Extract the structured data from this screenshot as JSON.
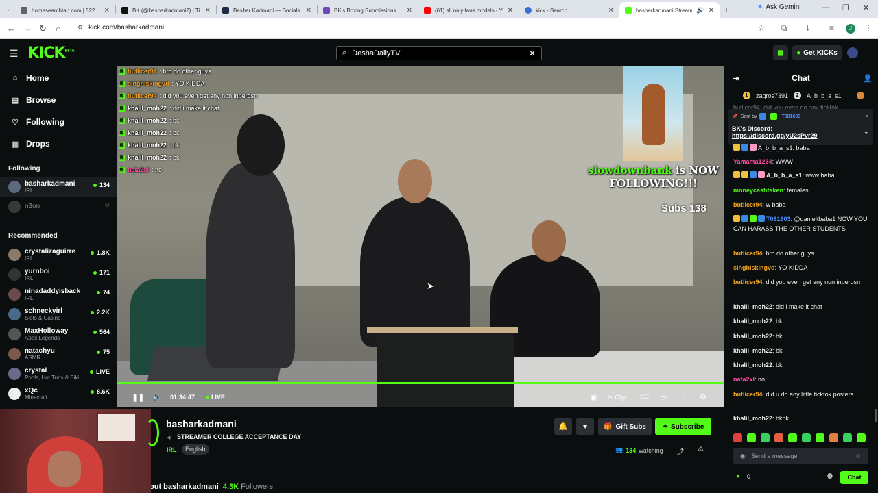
{
  "browser": {
    "tabs": [
      {
        "title": "homesearchtab.com | 522",
        "color": "#5f6368"
      },
      {
        "title": "BK (@basharkadmani2) | Ti",
        "color": "#111111"
      },
      {
        "title": "Bashar Kadmani — Socials",
        "color": "#1f2a44"
      },
      {
        "title": "BK's Boxing Submissions",
        "color": "#7248b9"
      },
      {
        "title": "(61) all only fans models - Y",
        "color": "#ff0000"
      },
      {
        "title": "kick - Search",
        "color": "#3b6fd6"
      },
      {
        "title": "basharkadmani Stream",
        "color": "#53fc18"
      }
    ],
    "gemini_label": "Ask Gemini",
    "url": "kick.com/basharkadmani",
    "profile_letter": "J"
  },
  "header": {
    "logo": "KICK",
    "logo_sup": "BETA",
    "search_value": "DeshaDailyTV",
    "get_kicks": "Get KICKs"
  },
  "sidebar": {
    "nav": [
      {
        "label": "Home",
        "icon": "home-icon"
      },
      {
        "label": "Browse",
        "icon": "browse-icon"
      },
      {
        "label": "Following",
        "icon": "heart-icon"
      },
      {
        "label": "Drops",
        "icon": "drops-icon"
      }
    ],
    "following_heading": "Following",
    "following": [
      {
        "name": "basharkadmani",
        "category": "IRL",
        "viewers": "134"
      },
      {
        "name": "n3on",
        "category": "",
        "viewers": ""
      }
    ],
    "recommended_heading": "Recommended",
    "recommended": [
      {
        "name": "crystalizaguirre",
        "category": "IRL",
        "viewers": "1.8K"
      },
      {
        "name": "yurnboi",
        "category": "IRL",
        "viewers": "171"
      },
      {
        "name": "ninadaddyisback",
        "category": "IRL",
        "viewers": "74"
      },
      {
        "name": "schneckyirl",
        "category": "Slots & Casino",
        "viewers": "2.2K"
      },
      {
        "name": "MaxHolloway",
        "category": "Apex Legends",
        "viewers": "564"
      },
      {
        "name": "natachyu",
        "category": "ASMR",
        "viewers": "75"
      },
      {
        "name": "crystal",
        "category": "Pools, Hot Tubs & Biki...",
        "viewers": "LIVE"
      },
      {
        "name": "xQc",
        "category": "Minecraft",
        "viewers": "8.6K"
      }
    ]
  },
  "video": {
    "overlay_chat": [
      {
        "user": "butlicer94",
        "color": "#f0a020",
        "text": ": bro do other guys"
      },
      {
        "user": "singhiskingvd",
        "color": "#f0a020",
        "text": ": YO KIDDA"
      },
      {
        "user": "butlicer94",
        "color": "#f0a020",
        "text": ": did you even get any non inperosn"
      },
      {
        "user": "khalil_moh22",
        "color": "#ffffff",
        "text": ": did i make it chat"
      },
      {
        "user": "khalil_moh22",
        "color": "#ffffff",
        "text": ": bk"
      },
      {
        "user": "khalil_moh22",
        "color": "#ffffff",
        "text": ": bk"
      },
      {
        "user": "khalil_moh22",
        "color": "#ffffff",
        "text": ": bk"
      },
      {
        "user": "khalil_moh22",
        "color": "#ffffff",
        "text": ": bk"
      },
      {
        "user": "nata2xl",
        "color": "#ff4fa0",
        "text": ": no"
      }
    ],
    "alert_name": "slowdownbank",
    "alert_text_1": " is NOW",
    "alert_text_2": "FOLLOWING!!!",
    "subs": "Subs 138",
    "time": "01:34:47",
    "live": "LIVE",
    "clip": "Clip"
  },
  "channel": {
    "name": "basharkadmani",
    "title": "STREAMER COLLEGE ACCEPTANCE DAY",
    "category": "IRL",
    "language": "English",
    "gift": "Gift Subs",
    "subscribe": "Subscribe",
    "watching_count": "134",
    "watching_label": "watching",
    "about_prefix": "out basharkadmani",
    "followers_count": "4.3K",
    "followers_label": "Followers"
  },
  "chat": {
    "title": "Chat",
    "leaderboard": [
      {
        "name": "zagros7391",
        "rank": "1"
      },
      {
        "name": "A_b_b_a_s1",
        "rank": "2"
      }
    ],
    "pinned": {
      "sent_by": "Sent by",
      "sender": "T081603",
      "text": "BK's Discord:",
      "link": "https://discord.gg/yU2sPvr29"
    },
    "messages": [
      {
        "user": "",
        "color": "#ffffff",
        "text": "A_b_b_a_s1: baba"
      },
      {
        "user": "Yamama1234",
        "color": "#ff4fa0",
        "text": ": WWW"
      },
      {
        "user": "A_b_b_a_s1",
        "color": "#ffffff",
        "text": ": www baba"
      },
      {
        "user": "moneycashtaken",
        "color": "#53fc18",
        "text": ": females"
      },
      {
        "user": "butlicer94",
        "color": "#f0a020",
        "text": ": w baba"
      },
      {
        "user": "T081603",
        "color": "#4f8fff",
        "text": ": @danieltbaba1 NOW YOU CAN HARASS THE OTHER STUDENTS"
      },
      {
        "user": "butlicer94",
        "color": "#f0a020",
        "text": ": bro do other guys"
      },
      {
        "user": "singhiskingvd",
        "color": "#f0a020",
        "text": ": YO KIDDA"
      },
      {
        "user": "butlicer94",
        "color": "#f0a020",
        "text": ": did you even get any non inperosn"
      },
      {
        "user": "khalil_moh22",
        "color": "#ffffff",
        "text": ": did i make it chat"
      },
      {
        "user": "khalil_moh22",
        "color": "#ffffff",
        "text": ": bk"
      },
      {
        "user": "khalil_moh22",
        "color": "#ffffff",
        "text": ": bk"
      },
      {
        "user": "khalil_moh22",
        "color": "#ffffff",
        "text": ": bk"
      },
      {
        "user": "khalil_moh22",
        "color": "#ffffff",
        "text": ": bk"
      },
      {
        "user": "nata2xl",
        "color": "#ff4fa0",
        "text": ": no"
      },
      {
        "user": "butlicer94",
        "color": "#f0a020",
        "text": ": did u do any little ticktok posters"
      },
      {
        "user": "khalil_moh22",
        "color": "#ffffff",
        "text": ": bkbk"
      }
    ],
    "placeholder": "Send a message",
    "kicks_balance": "0",
    "chat_button": "Chat"
  },
  "colors": {
    "accent": "#53fc18",
    "bg": "#0b0e0f"
  }
}
